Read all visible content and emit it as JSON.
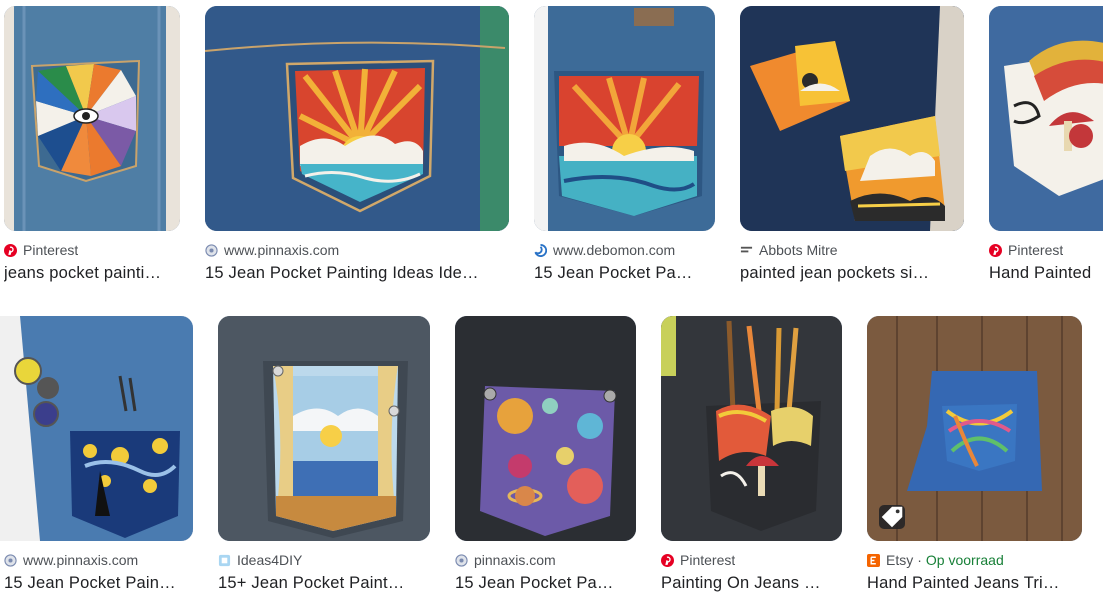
{
  "results": [
    {
      "source": "Pinterest",
      "favicon": "pinterest-icon",
      "title": "jeans pocket painti…"
    },
    {
      "source": "www.pinnaxis.com",
      "favicon": "globe-icon",
      "title": "15 Jean Pocket Painting Ideas Ide…"
    },
    {
      "source": "www.debomon.com",
      "favicon": "swirl-icon",
      "title": "15 Jean Pocket Pa…"
    },
    {
      "source": "Abbots Mitre",
      "favicon": "lines-icon",
      "title": "painted jean pockets si…"
    },
    {
      "source": "Pinterest",
      "favicon": "pinterest-icon",
      "title": "Hand Painted"
    },
    {
      "source": "www.pinnaxis.com",
      "favicon": "globe-icon",
      "title": "15 Jean Pocket Pain…"
    },
    {
      "source": "Ideas4DIY",
      "favicon": "ideas4diy-icon",
      "title": "15+ Jean Pocket Paint…"
    },
    {
      "source": "pinnaxis.com",
      "favicon": "globe-icon",
      "title": "15 Jean Pocket Pa…"
    },
    {
      "source": "Pinterest",
      "favicon": "pinterest-icon",
      "title": "Painting On Jeans …"
    },
    {
      "source": "Etsy",
      "favicon": "etsy-icon",
      "title": "Hand Painted Jeans Tri…",
      "separator": "·",
      "stock": "Op voorraad"
    }
  ],
  "colors": {
    "pinterest": "#e60023",
    "etsy": "#f56400",
    "in_stock": "#188038",
    "source_text": "#4d5156",
    "title_text": "#202124"
  }
}
